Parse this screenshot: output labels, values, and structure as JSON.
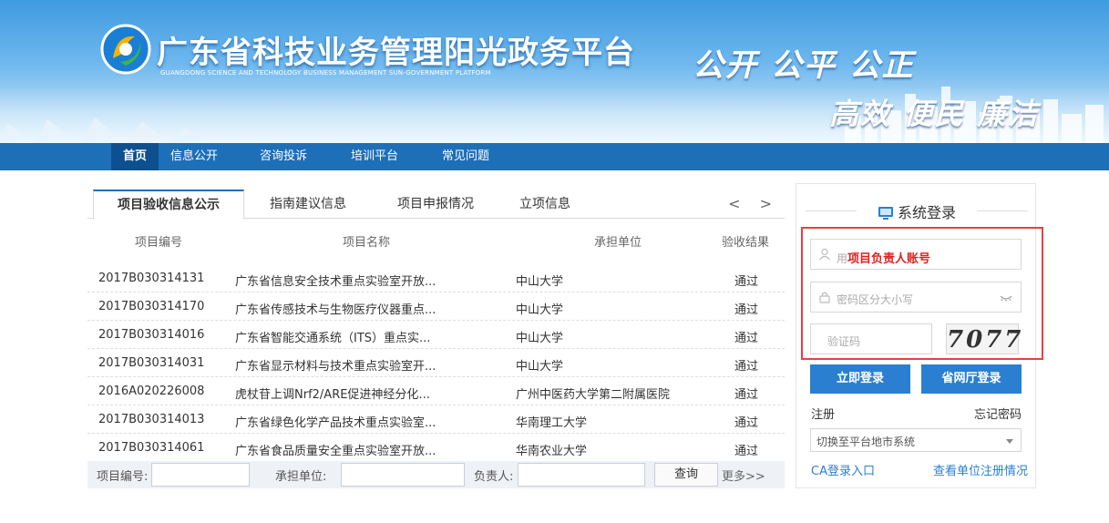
{
  "header": {
    "site_title": "广东省科技业务管理阳光政务平台",
    "site_subtitle": "GUANGDONG SCIENCE AND TECHNOLOGY BUSINESS MANAGEMENT SUN-GOVERNMENT PLATFORM",
    "slogan_line1": "公开 公平 公正",
    "slogan_line2": "高效 便民 廉洁"
  },
  "nav": {
    "items": [
      {
        "label": "首页",
        "active": true
      },
      {
        "label": "信息公开",
        "active": false
      },
      {
        "label": "咨询投诉",
        "active": false
      },
      {
        "label": "培训平台",
        "active": false
      },
      {
        "label": "常见问题",
        "active": false
      }
    ]
  },
  "tabs": {
    "items": [
      {
        "label": "项目验收信息公示",
        "active": true
      },
      {
        "label": "指南建议信息",
        "active": false
      },
      {
        "label": "项目申报情况",
        "active": false
      },
      {
        "label": "立项信息",
        "active": false
      }
    ],
    "arrows": "< >"
  },
  "table": {
    "headers": [
      "项目编号",
      "项目名称",
      "承担单位",
      "验收结果"
    ],
    "rows": [
      [
        "2017B030314131",
        "广东省信息安全技术重点实验室开放...",
        "中山大学",
        "通过"
      ],
      [
        "2017B030314170",
        "广东省传感技术与生物医疗仪器重点...",
        "中山大学",
        "通过"
      ],
      [
        "2017B030314016",
        "广东省智能交通系统（ITS）重点实...",
        "中山大学",
        "通过"
      ],
      [
        "2017B030314031",
        "广东省显示材料与技术重点实验室开...",
        "中山大学",
        "通过"
      ],
      [
        "2016A020226008",
        "虎杖苷上调Nrf2/ARE促进神经分化...",
        "广州中医药大学第二附属医院",
        "通过"
      ],
      [
        "2017B030314013",
        "广东省绿色化学产品技术重点实验室...",
        "华南理工大学",
        "通过"
      ],
      [
        "2017B030314061",
        "广东省食品质量安全重点实验室开放...",
        "华南农业大学",
        "通过"
      ]
    ]
  },
  "search": {
    "project_no_label": "项目编号:",
    "unit_label": "承担单位:",
    "leader_label": "负责人:",
    "query_button": "查询",
    "more_link": "更多>>"
  },
  "login": {
    "title": "系统登录",
    "account_placeholder_prefix": "用",
    "account_hint": "项目负责人账号",
    "password_placeholder": "密码区分大小写",
    "captcha_placeholder": "验证码",
    "captcha_code": "7077",
    "login_button": "立即登录",
    "gov_login_button": "省网厅登录",
    "register_link": "注册",
    "forgot_link": "忘记密码",
    "switch_select": "切换至平台地市系统",
    "ca_link": "CA登录入口",
    "check_link": "查看单位注册情况"
  },
  "colors": {
    "nav_bg": "#1d6fb8",
    "button_bg": "#2a7fd0",
    "highlight_border": "#e84040",
    "hint_red": "#e02020"
  }
}
